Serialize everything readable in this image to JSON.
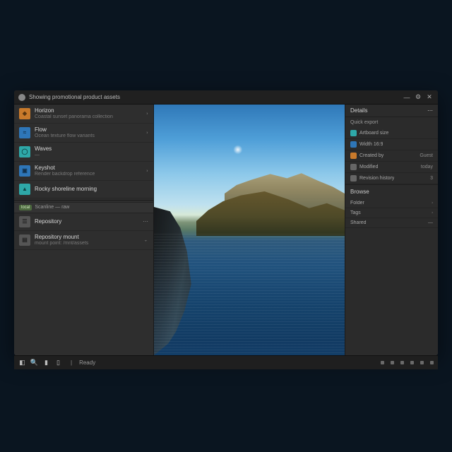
{
  "window": {
    "title": "Showing promotional product assets"
  },
  "left": {
    "items": [
      {
        "title": "Horizon",
        "sub": "Coastal sunset panorama collection",
        "thumb": "orange",
        "chev": true
      },
      {
        "title": "Flow",
        "sub": "Ocean texture flow variants",
        "thumb": "blue",
        "chev": true
      },
      {
        "title": "Waves",
        "sub": "—",
        "thumb": "teal",
        "chev": false
      },
      {
        "title": "Keyshot",
        "sub": "Render backdrop reference",
        "thumb": "blue",
        "chev": true
      },
      {
        "title": "Rocky shoreline morning",
        "sub": "",
        "thumb": "teal",
        "chev": false
      }
    ],
    "compact_row": {
      "pill": "local",
      "text": "Scanline — raw"
    },
    "items2": [
      {
        "title": "Repository",
        "sub": "",
        "thumb": "gray",
        "chev": "more"
      },
      {
        "title": "Repository mount",
        "sub": "mount point: /mnt/assets",
        "thumb": "gray",
        "chev": "down"
      }
    ]
  },
  "right": {
    "header": "Details",
    "section1": "Quick export",
    "rows1": [
      {
        "icon": "teal",
        "k": "Artboard size",
        "v": ""
      },
      {
        "icon": "blue",
        "k": "Width 16:9",
        "v": ""
      }
    ],
    "ownerRow": {
      "k": "Created by",
      "v": "Guest"
    },
    "rows2": [
      {
        "icon": "gray",
        "k": "Modified",
        "v": "today"
      },
      {
        "icon": "gray",
        "k": "Revision history",
        "v": "3"
      }
    ],
    "header2": "Browse",
    "rows3": [
      {
        "k": "Folder",
        "v": ""
      },
      {
        "k": "Tags",
        "v": ""
      },
      {
        "k": "Shared",
        "v": "—"
      }
    ]
  },
  "taskbar": {
    "status": "Ready"
  }
}
